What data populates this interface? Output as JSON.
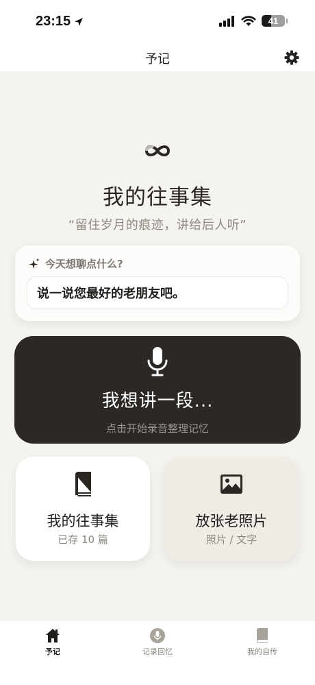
{
  "status": {
    "time": "23:15",
    "battery_level": 41,
    "battery_text": "41"
  },
  "header": {
    "title": "予记"
  },
  "hero": {
    "title": "我的往事集",
    "subtitle": "“留住岁月的痕迹，讲给后人听”"
  },
  "prompt": {
    "heading": "今天想聊点什么?",
    "suggestion": "说一说您最好的老朋友吧。"
  },
  "record": {
    "title": "我想讲一段...",
    "subtitle": "点击开始录音整理记忆"
  },
  "tiles": [
    {
      "title": "我的往事集",
      "subtitle": "已存 10 篇",
      "icon": "book-icon"
    },
    {
      "title": "放张老照片",
      "subtitle": "照片 / 文字",
      "icon": "image-icon"
    }
  ],
  "tabs": [
    {
      "label": "予记",
      "icon": "home-icon",
      "active": true
    },
    {
      "label": "记录回忆",
      "icon": "mic-circle-icon",
      "active": false
    },
    {
      "label": "我的自传",
      "icon": "book-icon",
      "active": false
    }
  ],
  "colors": {
    "background": "#f5f3ee",
    "dark_card": "#2b2825",
    "muted_text": "#8d8982"
  }
}
